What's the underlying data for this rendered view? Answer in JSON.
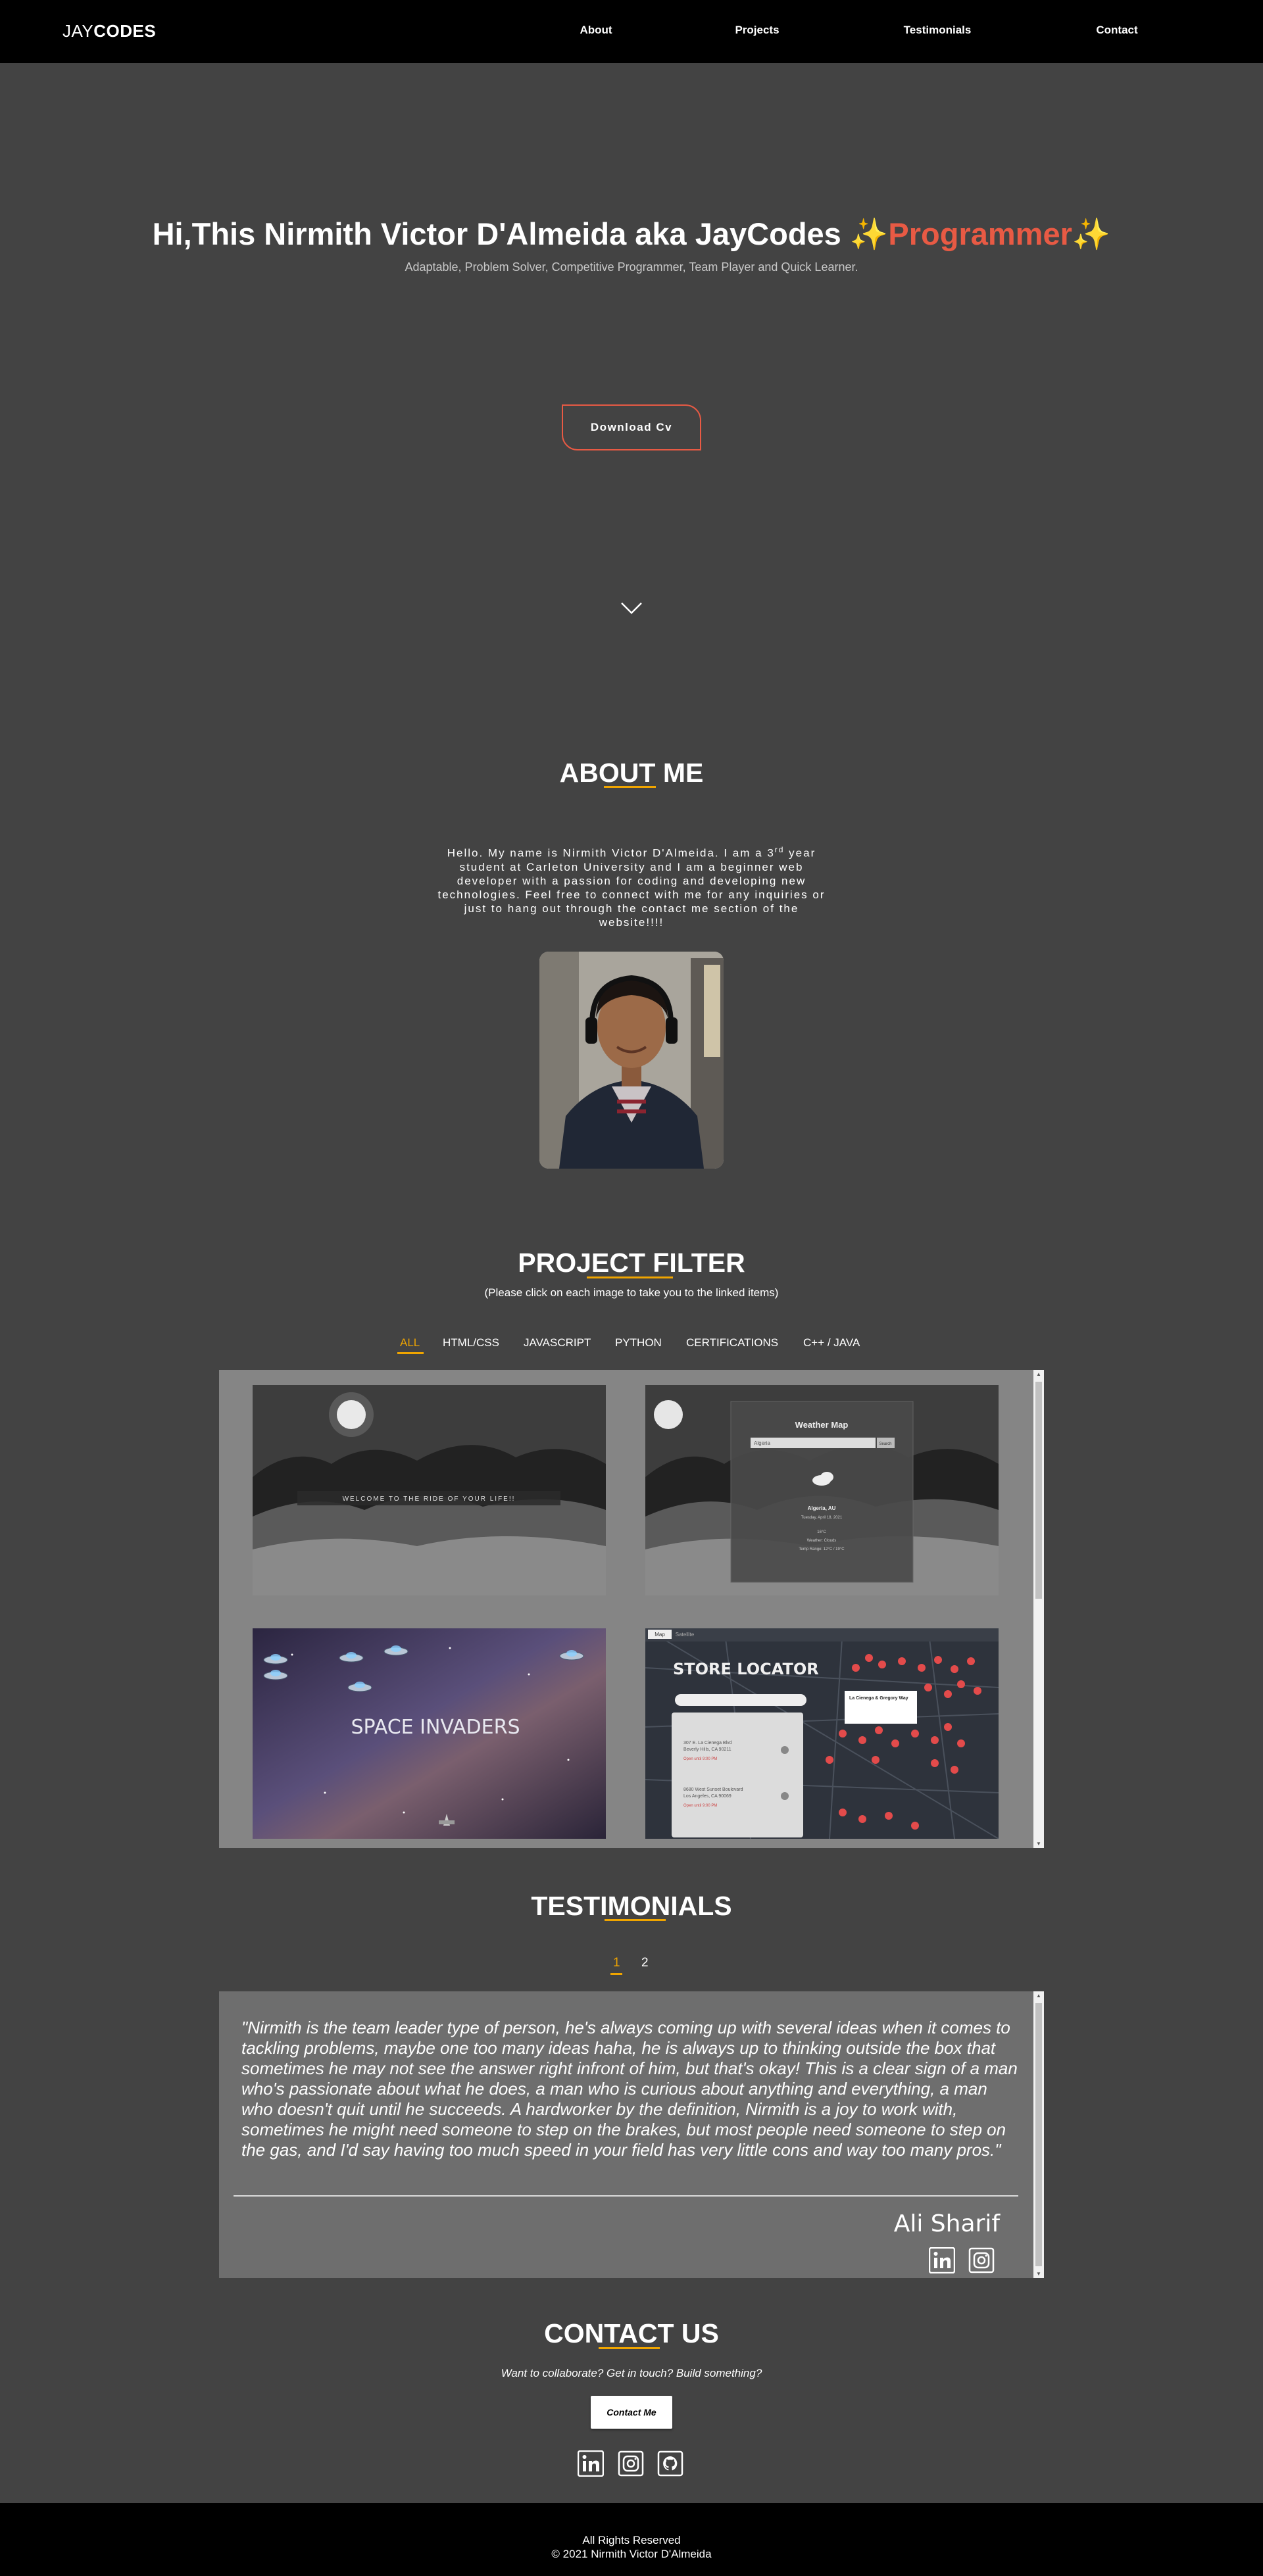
{
  "nav": {
    "brand_light": "JAY",
    "brand_bold": "CODES",
    "links": [
      "About",
      "Projects",
      "Testimonials",
      "Contact"
    ]
  },
  "hero": {
    "title_start": "Hi,This Nirmith Victor D'Almeida aka JayCodes ",
    "sparkle_left": "✨",
    "title_accent": "Programmer",
    "sparkle_right": "✨",
    "subtitle": "Adaptable, Problem Solver, Competitive Programmer, Team Player and Quick Learner.",
    "cv_button": "Download Cv",
    "scroll_icon": "chevron-down-icon"
  },
  "about": {
    "heading": "ABOUT ME",
    "text_before_sup": "Hello. My name is Nirmith Victor D'Almeida. I am a 3",
    "text_sup": "rd",
    "text_after_sup": " year student at Carleton University and I am a beginner web developer with a passion for coding and developing new technologies. Feel free to connect with me for any inquiries or just to hang out through the contact me section of the website!!!!"
  },
  "projects": {
    "heading": "PROJECT FILTER",
    "subtitle": "(Please click on each image to take you to the linked items)",
    "filters": [
      "ALL",
      "HTML/CSS",
      "JAVASCRIPT",
      "PYTHON",
      "CERTIFICATIONS",
      "C++ / JAVA"
    ],
    "active_filter": "ALL",
    "items": [
      {
        "overlay_text": "WELCOME TO THE RIDE OF YOUR LIFE!!"
      },
      {
        "card_title": "Weather Map",
        "input_value": "Algeria",
        "button": "Search",
        "city": "Algeria, AU",
        "date": "Tuesday, April 18, 2021",
        "temp": "16°C",
        "cond": "Weather: Clouds",
        "range": "Temp Range: 12°C / 19°C"
      },
      {
        "title": "SPACE INVADERS"
      },
      {
        "title": "STORE LOCATOR",
        "tab_map": "Map",
        "tab_satellite": "Satellite",
        "popup_title": "La Cienega & Gregory Way",
        "result1_line1": "307 E. La Cienega Blvd",
        "result1_line2": "Beverly Hills, CA 90211",
        "result1_status": "Open until 9:00 PM",
        "result2_line1": "8680 West Sunset Boulevard",
        "result2_line2": "Los Angeles, CA 90069",
        "result2_status": "Open until 9:00 PM"
      }
    ]
  },
  "testimonials": {
    "heading": "TESTIMONIALS",
    "pages": [
      "1",
      "2"
    ],
    "active_page": "1",
    "quote": "\"Nirmith is the team leader type of person, he's always coming up with several ideas when it comes to tackling problems, maybe one too many ideas haha, he is always up to thinking outside the box that sometimes he may not see the answer right infront of him, but that's okay! This is a clear sign of a man who's passionate about what he does, a man who is curious about anything and everything, a man who doesn't quit until he succeeds. A hardworker by the definition, Nirmith is a joy to work with, sometimes he might need someone to step on the brakes, but most people need someone to step on the gas, and I'd say having too much speed in your field has very little cons and way too many pros.\"",
    "name": "Ali Sharif"
  },
  "contact": {
    "heading": "CONTACT US",
    "subtitle": "Want to collaborate? Get in touch? Build something?",
    "button": "Contact Me",
    "socials": [
      "linkedin-icon",
      "instagram-icon",
      "github-icon"
    ]
  },
  "footer": {
    "line1": "All Rights Reserved",
    "line2": "© 2021 Nirmith Victor D'Almeida"
  },
  "colors": {
    "background": "#434343",
    "nav": "#000000",
    "accent_orange": "#e85a44",
    "underline_gold": "#f0a500",
    "panel": "#858585"
  }
}
